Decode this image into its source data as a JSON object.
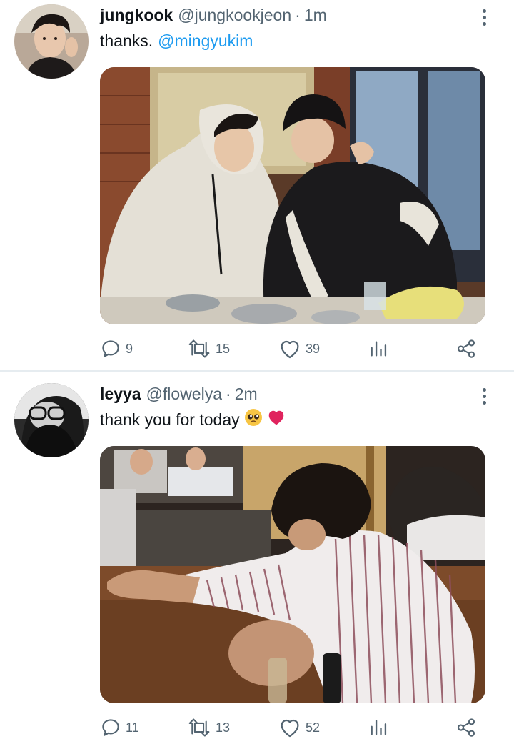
{
  "tweets": [
    {
      "display_name": "jungkook",
      "handle": "@jungkookjeon",
      "separator": "·",
      "time": "1m",
      "text": "thanks.",
      "mention": "@mingyukim",
      "emojis": [],
      "replies": "9",
      "retweets": "15",
      "likes": "39",
      "avatar_icon": "user-avatar-photo",
      "media": "photo"
    },
    {
      "display_name": "leyya",
      "handle": "@flowelya",
      "separator": "·",
      "time": "2m",
      "text": "thank you for today",
      "mention": "",
      "emojis": [
        "pleading-face-emoji",
        "red-heart-emoji"
      ],
      "replies": "11",
      "retweets": "13",
      "likes": "52",
      "avatar_icon": "user-avatar-photo",
      "media": "photo"
    }
  ],
  "icons": {
    "reply": "comment-icon",
    "retweet": "retweet-icon",
    "like": "heart-icon",
    "stats": "analytics-icon",
    "share": "share-icon",
    "more": "more-options-icon"
  },
  "colors": {
    "text_primary": "#0f1419",
    "text_secondary": "#536471",
    "link": "#1d9bf0",
    "divider": "#e6ecf0",
    "heart": "#e0245e"
  }
}
